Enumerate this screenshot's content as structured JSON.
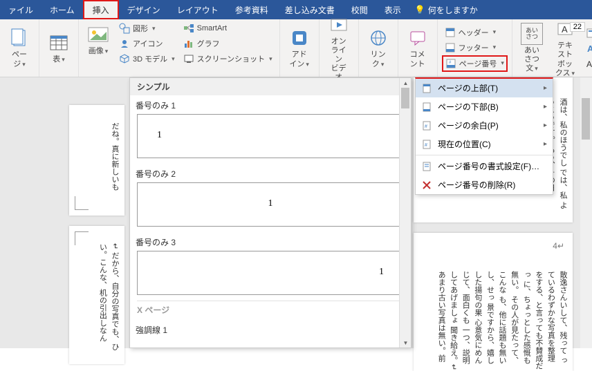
{
  "tabs": {
    "file": "ァイル",
    "home": "ホーム",
    "insert": "挿入",
    "design": "デザイン",
    "layout": "レイアウト",
    "references": "参考資料",
    "mailings": "差し込み文書",
    "review": "校閲",
    "view": "表示",
    "tellme": "何をしますか"
  },
  "ribbon": {
    "pages": "ページ",
    "table": "表",
    "image": "画像",
    "shapes": "図形",
    "icons": "アイコン",
    "model3d": "3D モデル",
    "smartart": "SmartArt",
    "chart": "グラフ",
    "screenshot": "スクリーンショット",
    "addins_l1": "アド",
    "addins_l2": "イン",
    "olvideo_l1": "オンライン",
    "olvideo_l2": "ビデオ",
    "link_l1": "リン",
    "link_l2": "ク",
    "comment": "コメント",
    "header": "ヘッダー",
    "footer": "フッター",
    "pagenumber": "ページ番号",
    "aisatsu_l1": "あいさつ",
    "aisatsu_l2": "文",
    "textbox_l1": "テキスト",
    "textbox_l2": "ボックス"
  },
  "menu": {
    "top": "ページの上部(T)",
    "bottom": "ページの下部(B)",
    "margin": "ページの余白(P)",
    "current": "現在の位置(C)",
    "format": "ページ番号の書式設定(F)…",
    "remove": "ページ番号の削除(R)"
  },
  "gallery": {
    "section_simple": "シンプル",
    "item1": "番号のみ 1",
    "item2": "番号のみ 2",
    "item3": "番号のみ 3",
    "section_x": "X ページ",
    "item_accent": "強調線 1",
    "sample_number": "1"
  },
  "doc": {
    "right_page_num": "4↵",
    "ruler_value": "22",
    "text_r1": "酒は、私のほうでし\nでは、私\nようこうです。\nもう、その日",
    "text_r2": "散逸さんいして、残って\nっているわずかな写真を整理\nをする、と言っても不賛成だっ\nに、ちょっとした感慨も無い。\nその人が見たって、こんな\nも、他に話題も無いし、せっ\n景ですから、嬉しした揚句の果\n心意気にめんじて、面白くも\n一つ、説明してあげましょ\n聞き給え。↵\nあまり古い写真は無い。前",
    "text_l1": "だね。真に新しいも",
    "text_l2": "↵\nだから、自分の写真でも、ひ\nい。こんな、机の引出しなん"
  }
}
